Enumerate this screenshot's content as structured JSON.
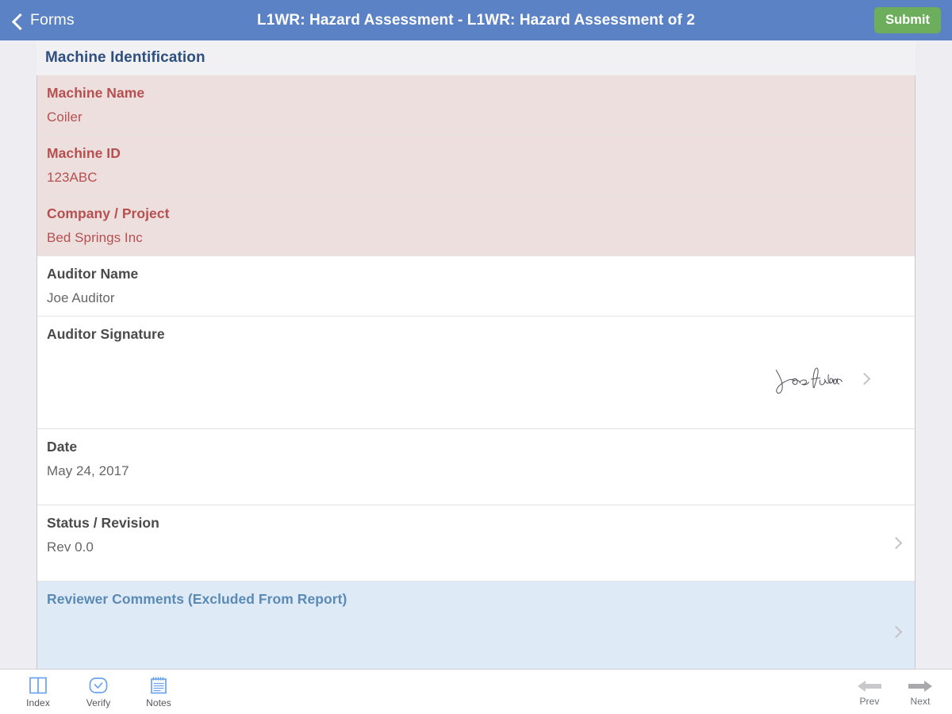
{
  "navbar": {
    "back_label": "Forms",
    "back_icon": "chevron-left-icon",
    "title": "L1WR: Hazard Assessment - L1WR: Hazard Assessment of 2",
    "submit_label": "Submit",
    "bar_color": "#5b82c4",
    "submit_color": "#6dae5c"
  },
  "section": {
    "title": "Machine Identification",
    "title_color": "#2e4f7f"
  },
  "colors": {
    "flagged_bg": "#eedfdf",
    "flagged_text": "#b5504f",
    "reviewer_bg": "#deeaf6",
    "reviewer_text": "#5b8ab5",
    "page_bg": "#eeedf2"
  },
  "rows": [
    {
      "label": "Machine Name",
      "value": "Coiler",
      "style": "flagged",
      "disclosure": false
    },
    {
      "label": "Machine ID",
      "value": "123ABC",
      "style": "flagged",
      "disclosure": false
    },
    {
      "label": "Company / Project",
      "value": "Bed Springs Inc",
      "style": "flagged",
      "disclosure": false
    },
    {
      "label": "Auditor Name",
      "value": "Joe Auditor",
      "style": "normal",
      "disclosure": false
    },
    {
      "label": "Auditor Signature",
      "value": "",
      "style": "signature",
      "disclosure": true,
      "signature_text": "Joe Auditor"
    },
    {
      "label": "Date",
      "value": "May 24, 2017",
      "style": "tall",
      "disclosure": false
    },
    {
      "label": "Status / Revision",
      "value": "Rev 0.0",
      "style": "tall",
      "disclosure": true
    },
    {
      "label": "Reviewer Comments (Excluded From Report)",
      "value": "",
      "style": "reviewer",
      "disclosure": true
    }
  ],
  "toolbar": {
    "tools": [
      {
        "label": "Index",
        "icon": "book-index-icon"
      },
      {
        "label": "Verify",
        "icon": "check-circle-icon"
      },
      {
        "label": "Notes",
        "icon": "notepad-icon"
      }
    ],
    "navigation": [
      {
        "label": "Prev",
        "icon": "arrow-left-icon",
        "state": "disabled"
      },
      {
        "label": "Next",
        "icon": "arrow-right-icon",
        "state": "enabled"
      }
    ]
  }
}
